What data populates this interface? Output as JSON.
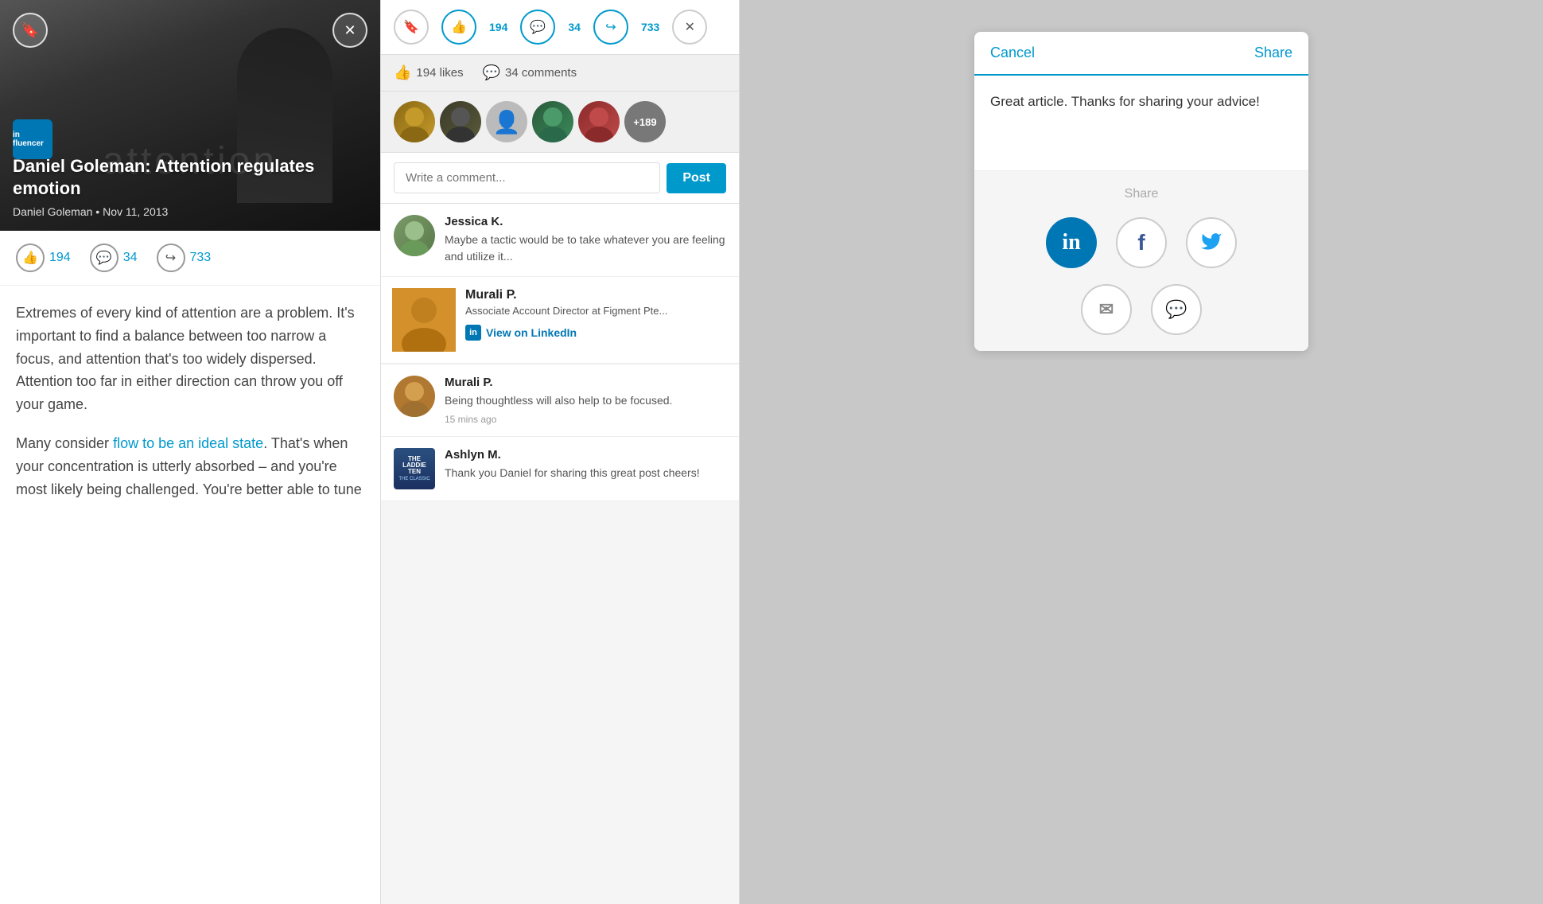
{
  "article": {
    "brand": "in fluencer",
    "hero_text": "attention",
    "title": "Daniel Goleman: Attention regulates emotion",
    "author": "Daniel Goleman",
    "date": "Nov 11, 2013",
    "like_count": "194",
    "comment_count": "34",
    "share_count": "733",
    "body_p1": "Extremes of every kind of attention are a problem. It's important to find a balance between too narrow a focus, and attention that's too widely dispersed. Attention too far in either direction can throw you off your game.",
    "body_p2_prefix": "Many consider ",
    "body_link": "flow to be an ideal state",
    "body_p2_suffix": ". That's when your concentration is utterly absorbed – and you're most likely being challenged. You're better able to tune",
    "bookmark_icon": "🔖",
    "close_icon": "✕"
  },
  "comments_panel": {
    "header_bookmark": "🔖",
    "header_like_icon": "👍",
    "header_like_count": "194",
    "header_comment_icon": "💬",
    "header_comment_count": "34",
    "header_share_icon": "↪",
    "header_share_count": "733",
    "header_close_icon": "✕",
    "stats_like_label": "194 likes",
    "stats_comment_label": "34 comments",
    "comment_placeholder": "Write a comment...",
    "post_button": "Post",
    "more_avatars": "+189",
    "comments": [
      {
        "name": "Jessica K.",
        "text": "Maybe a tactic would be to take whatever you are feeling and utilize it...",
        "time": "",
        "avatar_color": "#7a9a6a"
      },
      {
        "name": "Murali P.",
        "title": "Associate Account Director at Figment Pte...",
        "linkedin_label": "View on LinkedIn",
        "text": "",
        "time": "",
        "is_linkedin_card": true,
        "avatar_bg": "orange"
      },
      {
        "name": "Murali P.",
        "text": "Being thoughtless will also help to be focused.",
        "time": "15 mins ago",
        "avatar_bg": "brownish"
      },
      {
        "name": "Ashlyn M.",
        "text": "Thank you Daniel for sharing this great post cheers!",
        "time": "",
        "avatar_bg": "book"
      }
    ]
  },
  "share_panel": {
    "cancel_label": "Cancel",
    "share_header_label": "Share",
    "message_text": "Great article. Thanks for sharing your advice!",
    "share_section_label": "Share",
    "linkedin_label": "in",
    "facebook_label": "f",
    "twitter_label": "🐦",
    "email_label": "✉",
    "message_label": "💬"
  }
}
